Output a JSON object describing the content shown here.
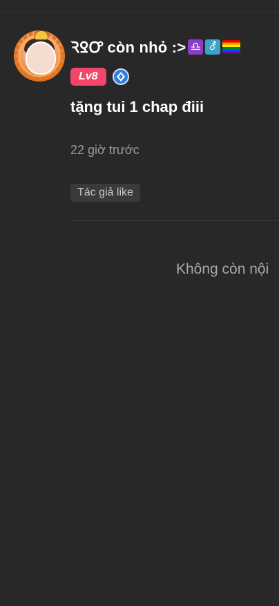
{
  "comment": {
    "username": "ꝚꝾꝌ còn nhỏ :>",
    "emojis": {
      "libra": "♎",
      "gender": "⚦"
    },
    "level_badge": "Lv8",
    "text": "tặng tui 1 chap điii",
    "timestamp": "22 giờ trước",
    "tag": "Tác giả like"
  },
  "feed": {
    "end_message": "Không còn nội"
  },
  "colors": {
    "background": "#282828",
    "level_badge": "#f4466a",
    "timestamp": "#9a9a9a",
    "tag_chip_bg": "#3a3a3a",
    "vip_icon": "#2f7fe0"
  }
}
